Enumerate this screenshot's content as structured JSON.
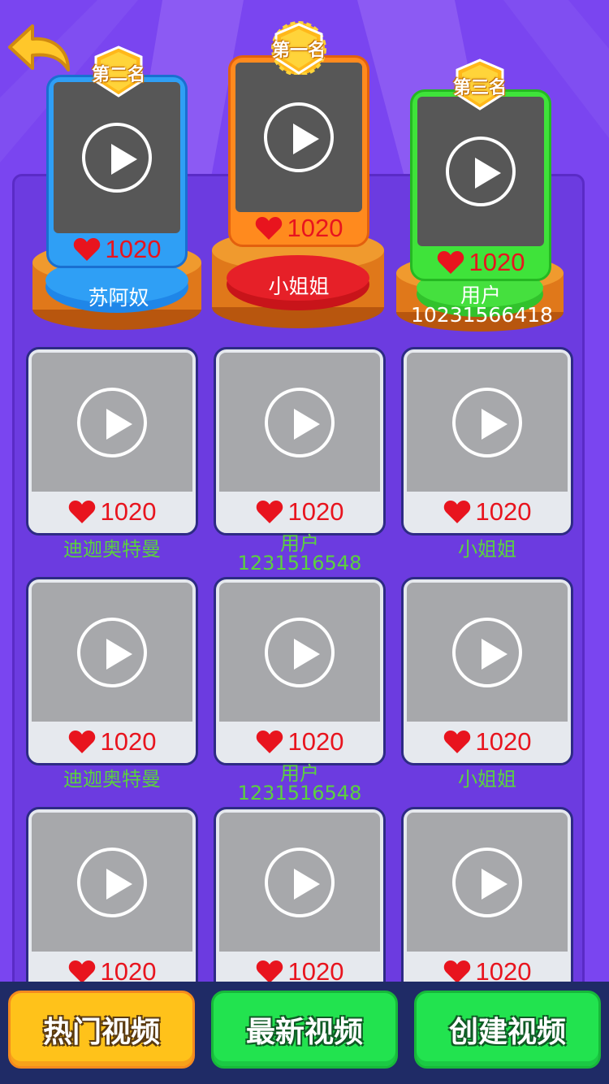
{
  "podium": [
    {
      "rank_label": "第二名",
      "likes": "1020",
      "name": "苏阿奴",
      "color": "#3aa8f5"
    },
    {
      "rank_label": "第一名",
      "likes": "1020",
      "name": "小姐姐",
      "color": "#ff8a1e"
    },
    {
      "rank_label": "第三名",
      "likes": "1020",
      "name": "用户 10231566418",
      "color": "#3fe33a"
    }
  ],
  "grid": [
    {
      "likes": "1020",
      "name": "迪迦奥特曼"
    },
    {
      "likes": "1020",
      "name": "用户 1231516548"
    },
    {
      "likes": "1020",
      "name": "小姐姐"
    },
    {
      "likes": "1020",
      "name": "迪迦奥特曼"
    },
    {
      "likes": "1020",
      "name": "用户 1231516548"
    },
    {
      "likes": "1020",
      "name": "小姐姐"
    },
    {
      "likes": "1020",
      "name": ""
    },
    {
      "likes": "1020",
      "name": ""
    },
    {
      "likes": "1020",
      "name": ""
    }
  ],
  "tabs": {
    "hot": "热门视频",
    "latest": "最新视频",
    "create": "创建视频"
  },
  "icons": {
    "back": "back-arrow-icon",
    "like": "heart-icon",
    "play": "play-icon"
  },
  "colors": {
    "background": "#7a45f0",
    "like_text": "#e8141e",
    "name_text": "#5bd13f",
    "tab_active": "#ffc21a",
    "tab_inactive": "#22e34f"
  }
}
